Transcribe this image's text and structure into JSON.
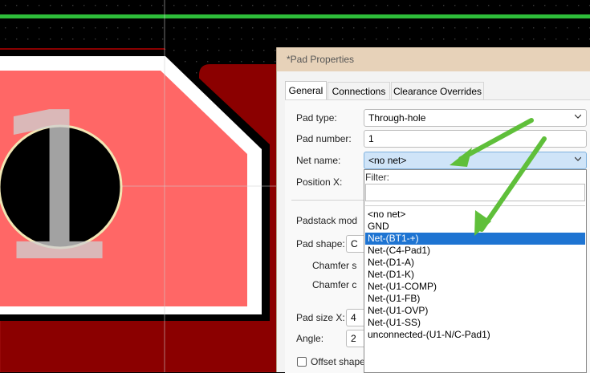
{
  "dialog": {
    "title": "*Pad Properties",
    "tabs": [
      "General",
      "Connections",
      "Clearance Overrides"
    ],
    "fields": {
      "pad_type": {
        "label": "Pad type:",
        "value": "Through-hole"
      },
      "pad_number": {
        "label": "Pad number:",
        "value": "1"
      },
      "net_name": {
        "label": "Net name:",
        "value": "<no net>"
      },
      "position_x": {
        "label": "Position X:"
      },
      "padstack_mode": {
        "label": "Padstack mod"
      },
      "pad_shape": {
        "label": "Pad shape:",
        "value": "C"
      },
      "chamfer_size": {
        "label": "Chamfer s"
      },
      "chamfer_corners": {
        "label": "Chamfer c"
      },
      "pad_size_x": {
        "label": "Pad size X:",
        "value": "4"
      },
      "angle": {
        "label": "Angle:",
        "value": "2"
      },
      "offset_shape": {
        "label": "Offset shape from hole"
      }
    },
    "dropdown": {
      "filter_label": "Filter:",
      "filter_value": "",
      "items": [
        "<no net>",
        "GND",
        "Net-(BT1-+)",
        "Net-(C4-Pad1)",
        "Net-(D1-A)",
        "Net-(D1-K)",
        "Net-(U1-COMP)",
        "Net-(U1-FB)",
        "Net-(U1-OVP)",
        "Net-(U1-SS)",
        "unconnected-(U1-N/C-Pad1)"
      ],
      "highlighted_index": 2
    }
  },
  "pcb": {
    "pad_label": "1",
    "colors": {
      "background": "#000000",
      "copper": "#8b0000",
      "pad_fill": "#ff6766",
      "outline": "#ffffff",
      "track": "#2ebd3a",
      "hole": "#000000",
      "hole_ring": "#f2e6b4"
    }
  },
  "annotation": {
    "arrow_color": "#5fbf3a"
  }
}
